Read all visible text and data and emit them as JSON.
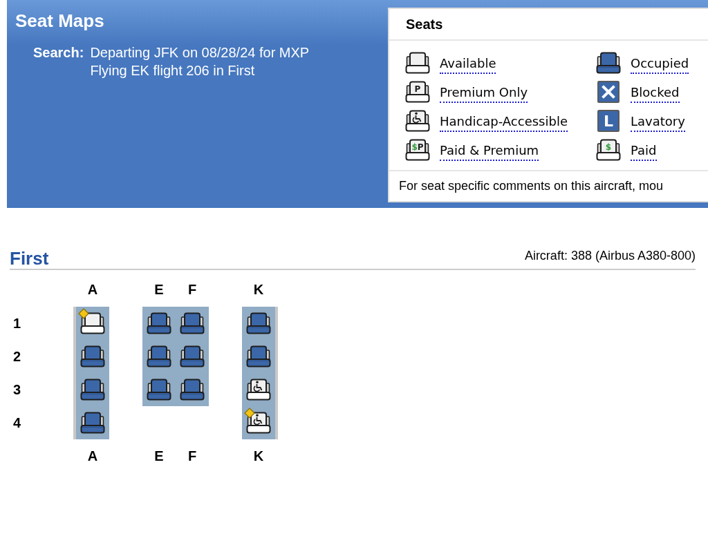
{
  "header": {
    "title": "Seat Maps",
    "search": {
      "label": "Search:",
      "lines": [
        "Departing JFK on 08/28/24 for MXP",
        "Flying EK flight 206 in First"
      ]
    }
  },
  "legend": {
    "title": "Seats",
    "items": [
      {
        "kind": "available",
        "label": "Available"
      },
      {
        "kind": "occupied",
        "label": "Occupied"
      },
      {
        "kind": "premium",
        "icon_text": [
          "P"
        ],
        "label": "Premium Only"
      },
      {
        "kind": "blocked",
        "label": "Blocked"
      },
      {
        "kind": "handicap",
        "label": "Handicap-Accessible"
      },
      {
        "kind": "lavatory",
        "icon_text": [
          "L"
        ],
        "label": "Lavatory"
      },
      {
        "kind": "paid_premium",
        "icon_text": [
          "$",
          "P"
        ],
        "label": "Paid & Premium"
      },
      {
        "kind": "paid",
        "icon_text": [
          "$"
        ],
        "label": "Paid"
      }
    ],
    "note": "For seat specific comments on this aircraft, mou"
  },
  "cabin": {
    "title": "First",
    "aircraft": "Aircraft: 388 (Airbus A380-800)",
    "row_numbers": [
      "1",
      "2",
      "3",
      "4"
    ],
    "sections": [
      {
        "kind": "wall_left",
        "columns": [
          {
            "top_label": "A",
            "bottom_label": "A",
            "seats": [
              {
                "kind": "available",
                "diamond_marker": true
              },
              {
                "kind": "occupied",
                "diamond_marker": false
              },
              {
                "kind": "occupied",
                "diamond_marker": false
              },
              {
                "kind": "occupied",
                "diamond_marker": false
              }
            ]
          }
        ]
      },
      {
        "kind": "middle",
        "columns": [
          {
            "top_label": "E",
            "bottom_label": "E",
            "seats": [
              {
                "kind": "occupied",
                "diamond_marker": false
              },
              {
                "kind": "occupied",
                "diamond_marker": false
              },
              {
                "kind": "occupied",
                "diamond_marker": false
              }
            ]
          },
          {
            "top_label": "F",
            "bottom_label": "F",
            "seats": [
              {
                "kind": "occupied",
                "diamond_marker": false
              },
              {
                "kind": "occupied",
                "diamond_marker": false
              },
              {
                "kind": "occupied",
                "diamond_marker": false
              }
            ]
          }
        ]
      },
      {
        "kind": "wall_right",
        "columns": [
          {
            "top_label": "K",
            "bottom_label": "K",
            "seats": [
              {
                "kind": "occupied",
                "diamond_marker": false
              },
              {
                "kind": "occupied",
                "diamond_marker": false
              },
              {
                "kind": "handicap",
                "diamond_marker": false
              },
              {
                "kind": "handicap",
                "diamond_marker": true
              }
            ]
          }
        ]
      }
    ]
  }
}
